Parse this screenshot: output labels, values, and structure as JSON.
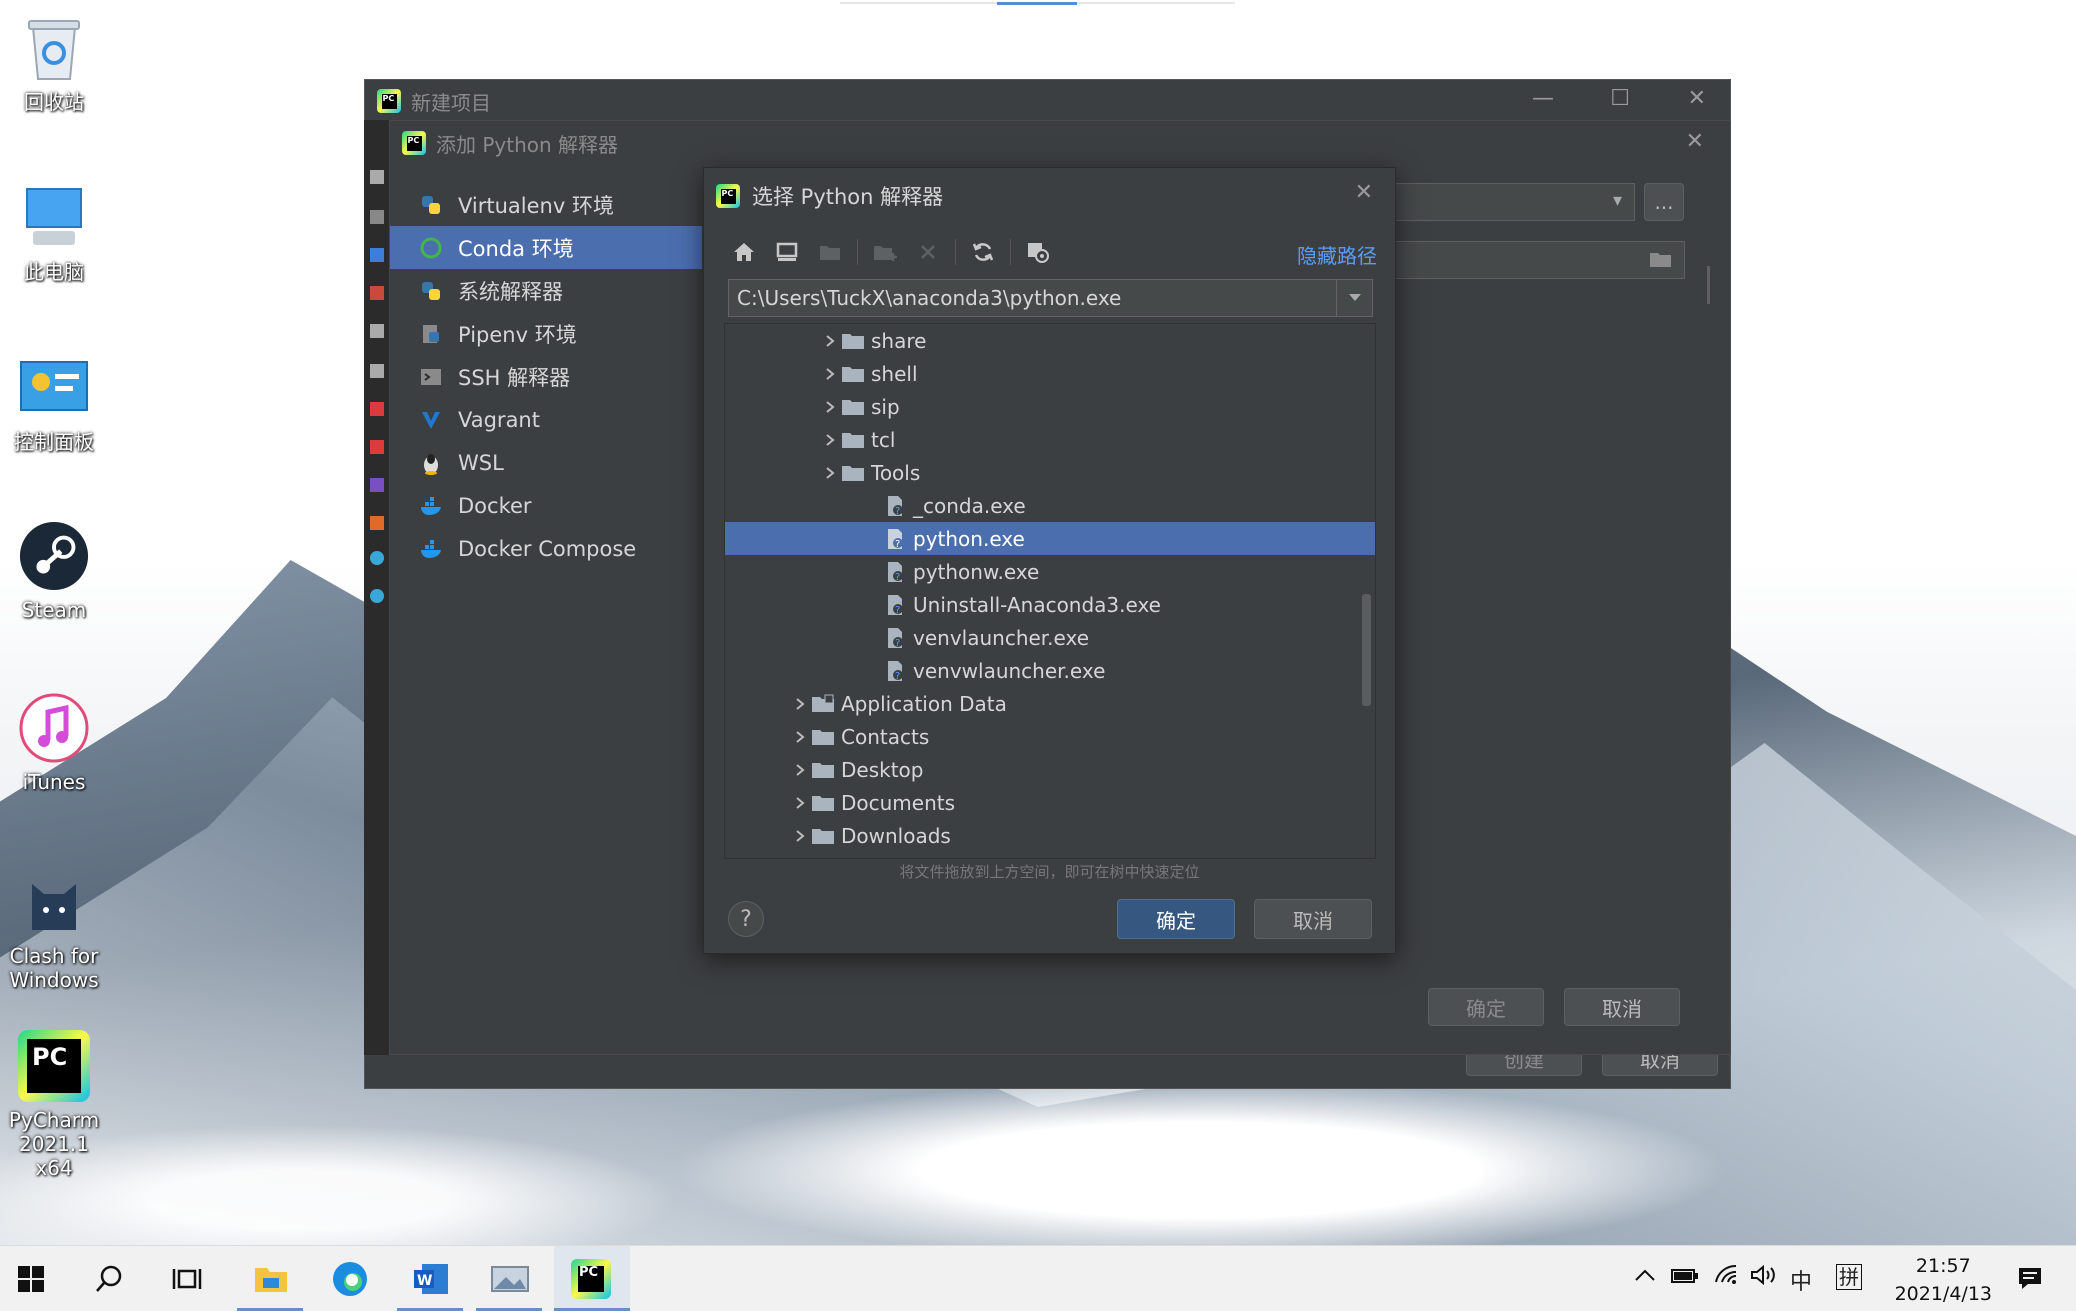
{
  "desktop": {
    "icons": [
      {
        "label": "回收站"
      },
      {
        "label": "此电脑"
      },
      {
        "label": "控制面板"
      },
      {
        "label": "Steam"
      },
      {
        "label": "iTunes"
      },
      {
        "label_line1": "Clash for",
        "label_line2": "Windows"
      },
      {
        "label_line1": "PyCharm",
        "label_line2": "2021.1 x64"
      }
    ]
  },
  "new_project_window": {
    "title": "新建项目",
    "create_label": "创建",
    "cancel_label": "取消"
  },
  "add_interpreter_dialog": {
    "title": "添加 Python 解释器",
    "types": [
      {
        "label": "Virtualenv 环境"
      },
      {
        "label": "Conda 环境",
        "selected": true
      },
      {
        "label": "系统解释器"
      },
      {
        "label": "Pipenv 环境"
      },
      {
        "label": "SSH 解释器"
      },
      {
        "label": "Vagrant"
      },
      {
        "label": "WSL"
      },
      {
        "label": "Docker"
      },
      {
        "label": "Docker Compose"
      }
    ],
    "more_button": "...",
    "ok_label": "确定",
    "cancel_label": "取消"
  },
  "chooser_dialog": {
    "title": "选择 Python 解释器",
    "hide_path_link": "隐藏路径",
    "path_value": "C:\\Users\\TuckX\\anaconda3\\python.exe",
    "tree": [
      {
        "name": "share",
        "kind": "folder"
      },
      {
        "name": "shell",
        "kind": "folder"
      },
      {
        "name": "sip",
        "kind": "folder"
      },
      {
        "name": "tcl",
        "kind": "folder"
      },
      {
        "name": "Tools",
        "kind": "folder"
      },
      {
        "name": "_conda.exe",
        "kind": "file"
      },
      {
        "name": "python.exe",
        "kind": "file",
        "selected": true
      },
      {
        "name": "pythonw.exe",
        "kind": "file"
      },
      {
        "name": "Uninstall-Anaconda3.exe",
        "kind": "file"
      },
      {
        "name": "venvlauncher.exe",
        "kind": "file"
      },
      {
        "name": "venvwlauncher.exe",
        "kind": "file"
      },
      {
        "name": "Application Data",
        "kind": "folder"
      },
      {
        "name": "Contacts",
        "kind": "folder"
      },
      {
        "name": "Desktop",
        "kind": "folder"
      },
      {
        "name": "Documents",
        "kind": "folder"
      },
      {
        "name": "Downloads",
        "kind": "folder"
      }
    ],
    "hint": "将文件拖放到上方空间，即可在树中快速定位",
    "help_label": "?",
    "ok_label": "确定",
    "cancel_label": "取消"
  },
  "taskbar": {
    "ime_mode": "中",
    "ime_name": "拼",
    "time": "21:57",
    "date": "2021/4/13"
  },
  "colors": {
    "selection": "#4b6eaf",
    "dialog_bg": "#3c3f41",
    "link": "#589df6",
    "primary_button": "#365880"
  }
}
